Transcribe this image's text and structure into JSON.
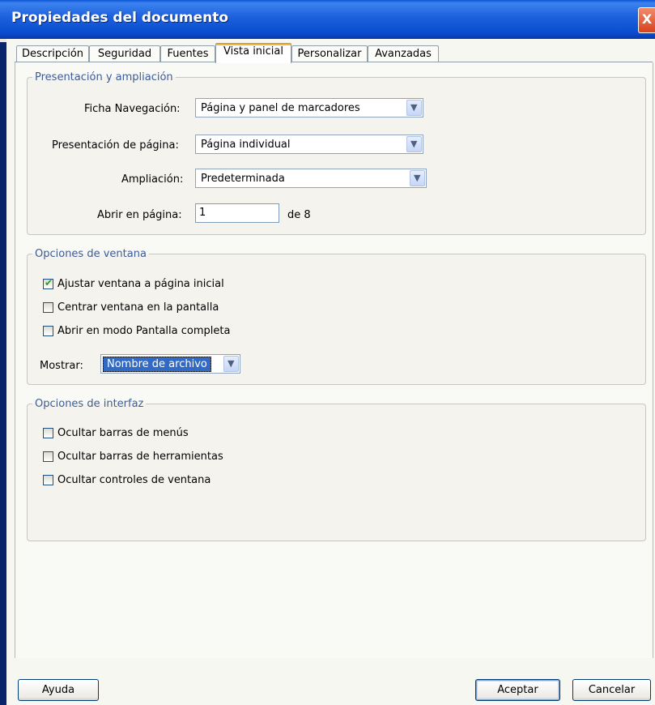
{
  "window": {
    "title": "Propiedades del documento",
    "close_glyph": "X"
  },
  "tabs": [
    {
      "label": "Descripción",
      "active": false
    },
    {
      "label": "Seguridad",
      "active": false
    },
    {
      "label": "Fuentes",
      "active": false
    },
    {
      "label": "Vista inicial",
      "active": true
    },
    {
      "label": "Personalizar",
      "active": false
    },
    {
      "label": "Avanzadas",
      "active": false
    }
  ],
  "layout_group": {
    "legend": "Presentación y ampliación",
    "navigation": {
      "label": "Ficha Navegación:",
      "value": "Página y panel de marcadores"
    },
    "page_layout": {
      "label": "Presentación de página:",
      "value": "Página individual"
    },
    "magnification": {
      "label": "Ampliación:",
      "value": "Predeterminada"
    },
    "open_to_page": {
      "label": "Abrir en página:",
      "value": "1",
      "suffix": "de 8"
    }
  },
  "window_group": {
    "legend": "Opciones de ventana",
    "checkboxes": [
      {
        "label": "Ajustar ventana a página inicial",
        "checked": true
      },
      {
        "label": "Centrar ventana en la pantalla",
        "checked": false
      },
      {
        "label": "Abrir en modo Pantalla completa",
        "checked": false
      }
    ],
    "show": {
      "label": "Mostrar:",
      "value": "Nombre de archivo"
    }
  },
  "interface_group": {
    "legend": "Opciones de interfaz",
    "checkboxes": [
      {
        "label": "Ocultar barras de menús",
        "checked": false
      },
      {
        "label": "Ocultar barras de herramientas",
        "checked": false
      },
      {
        "label": "Ocultar controles de ventana",
        "checked": false
      }
    ]
  },
  "footer": {
    "help": "Ayuda",
    "ok": "Aceptar",
    "cancel": "Cancelar"
  },
  "icons": {
    "dropdown": "chevron-down-icon",
    "check": "checkmark-icon",
    "close": "close-icon"
  },
  "colors": {
    "titlebar": "#0a4ccf",
    "tab_active_accent": "#f4b43a",
    "legend_text": "#3d5c96",
    "selection": "#316ac5"
  }
}
